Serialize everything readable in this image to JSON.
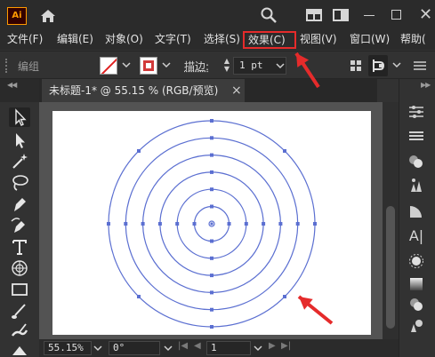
{
  "app": {
    "logo_text": "Ai"
  },
  "menu": {
    "items": [
      {
        "label": "文件(F)"
      },
      {
        "label": "编辑(E)"
      },
      {
        "label": "对象(O)"
      },
      {
        "label": "文字(T)"
      },
      {
        "label": "选择(S)"
      },
      {
        "label": "效果(C)",
        "highlighted": true
      },
      {
        "label": "视图(V)"
      },
      {
        "label": "窗口(W)"
      },
      {
        "label": "帮助("
      }
    ]
  },
  "control_bar": {
    "group_label": "编组",
    "stroke_label": "描边",
    "stroke_value": "1 pt"
  },
  "document": {
    "tab_title": "未标题-1* @ 55.15 % (RGB/预览)",
    "close_glyph": "×"
  },
  "status_bar": {
    "zoom": "55.15%",
    "rotation": "0°",
    "artboard_number": "1"
  },
  "artwork": {
    "circle_color": "#5b6fd1",
    "annotation_color": "#e52b2b",
    "circle_count": 6,
    "shape": "concentric circles"
  },
  "icons": {
    "titlebar": [
      "home-icon",
      "search-icon",
      "arrange-documents-icon",
      "panel-layout-icon",
      "minimize-icon",
      "maximize-icon",
      "close-icon"
    ],
    "tools": [
      "selection-tool-icon",
      "direct-selection-tool-icon",
      "magic-wand-icon",
      "lasso-icon",
      "pen-icon",
      "curvature-icon",
      "type-icon",
      "polar-grid-icon",
      "rectangle-icon",
      "paintbrush-icon",
      "blob-brush-icon",
      "eraser-icon"
    ],
    "right_panels": [
      "properties-icon",
      "layers-icon",
      "appearance-icon",
      "brushes-icon",
      "color-guide-icon",
      "character-icon",
      "sun-icon",
      "gradient-icon",
      "transparency-icon",
      "symbols-icon"
    ]
  }
}
